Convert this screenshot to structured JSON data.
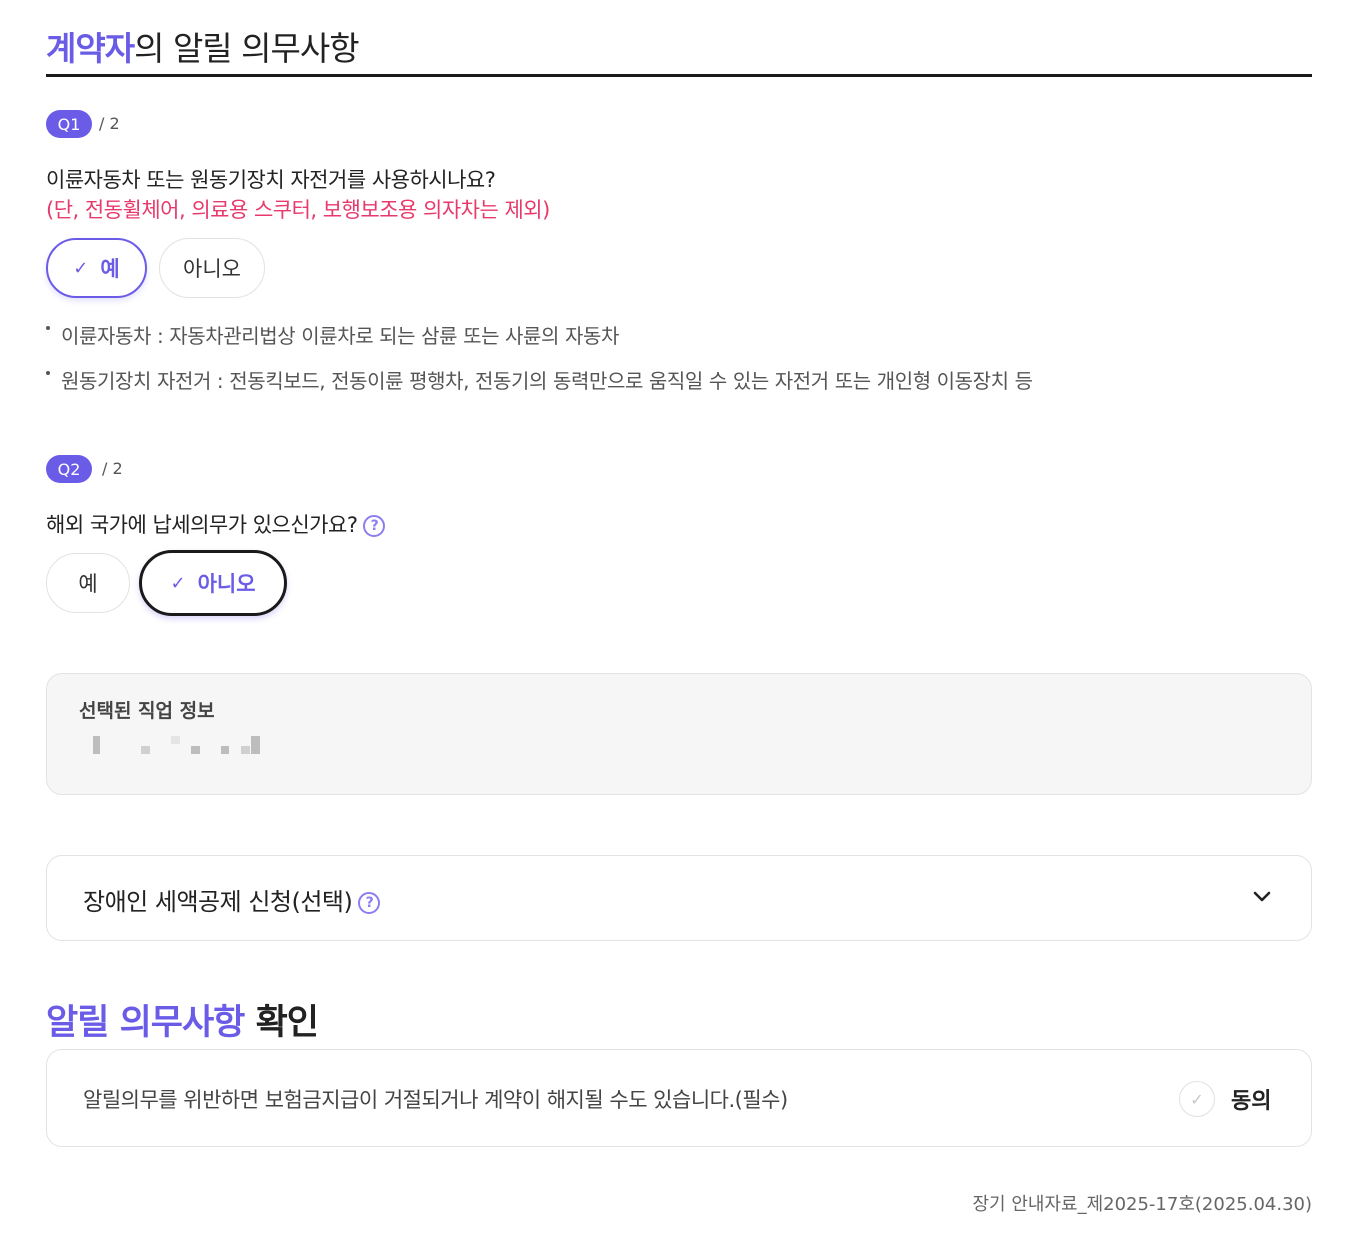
{
  "header": {
    "title_accent": "계약자",
    "title_rest": "의 알릴 의무사항"
  },
  "q1": {
    "badge": "Q1",
    "count": "/ 2",
    "question": "이륜자동차 또는 원동기장치 자전거를 사용하시나요?",
    "note": "(단, 전동휠체어, 의료용 스쿠터, 보행보조용 의자차는 제외)",
    "options": [
      {
        "label": "예",
        "selected": true
      },
      {
        "label": "아니오",
        "selected": false
      }
    ],
    "bullets": [
      "이륜자동차 : 자동차관리법상 이륜차로 되는 삼륜 또는 사륜의 자동차",
      "원동기장치 자전거 : 전동킥보드, 전동이륜 평행차, 전동기의 동력만으로 움직일 수 있는 자전거 또는 개인형 이동장치 등"
    ]
  },
  "q2": {
    "badge": "Q2",
    "count": "/ 2",
    "question": "해외 국가에 납세의무가 있으신가요?",
    "options": [
      {
        "label": "예",
        "selected": false
      },
      {
        "label": "아니오",
        "selected": true
      }
    ]
  },
  "job": {
    "label": "선택된 직업 정보",
    "value": ""
  },
  "accordion": {
    "label": "장애인 세액공제 신청(선택)"
  },
  "confirm": {
    "title_accent": "알릴 의무사항",
    "title_rest": "확인",
    "agree_text": "알릴의무를 위반하면 보험금지급이 거절되거나 계약이 해지될 수도 있습니다.(필수)",
    "agree_label": "동의",
    "agreed": false
  },
  "footer": {
    "note": "장기 안내자료_제2025-17호(2025.04.30)"
  },
  "icons": {
    "check": "check-icon",
    "help": "question-circle-icon",
    "chevron": "chevron-down-icon"
  },
  "colors": {
    "accent": "#6b5ce7",
    "warning": "#e8396c",
    "text": "#222222"
  }
}
